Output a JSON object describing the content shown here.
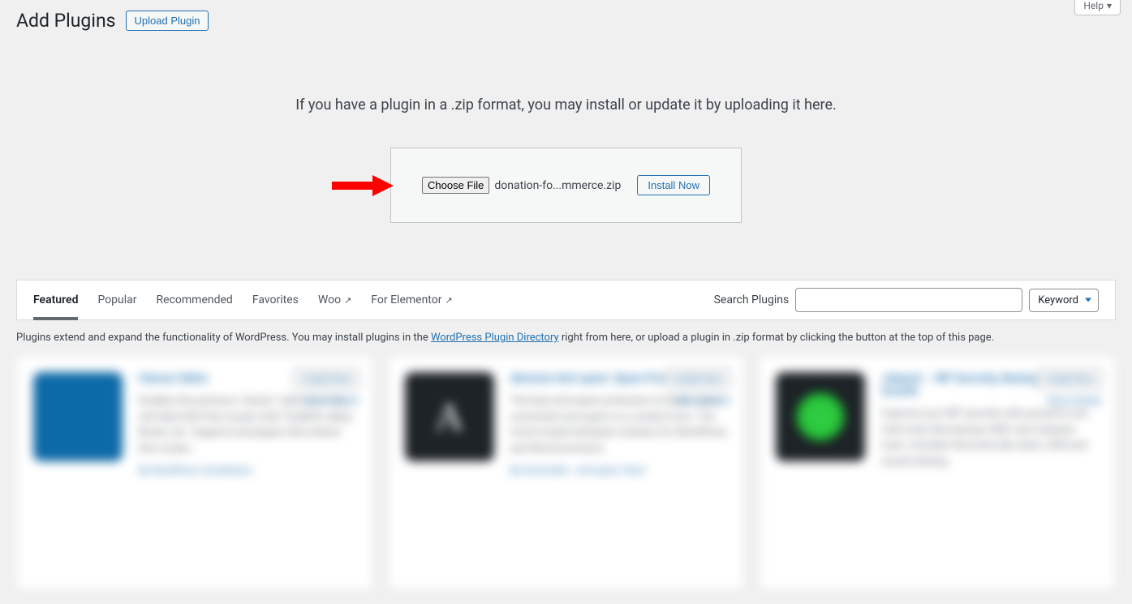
{
  "header": {
    "page_title": "Add Plugins",
    "upload_button": "Upload Plugin",
    "help_button": "Help"
  },
  "upload": {
    "description": "If you have a plugin in a .zip format, you may install or update it by uploading it here.",
    "choose_file_label": "Choose File",
    "selected_file": "donation-fo...mmerce.zip",
    "install_button": "Install Now"
  },
  "tabs": [
    {
      "label": "Featured",
      "active": true,
      "external": false
    },
    {
      "label": "Popular",
      "active": false,
      "external": false
    },
    {
      "label": "Recommended",
      "active": false,
      "external": false
    },
    {
      "label": "Favorites",
      "active": false,
      "external": false
    },
    {
      "label": "Woo",
      "active": false,
      "external": true
    },
    {
      "label": "For Elementor",
      "active": false,
      "external": true
    }
  ],
  "search": {
    "label": "Search Plugins",
    "keyword_label": "Keyword"
  },
  "description": {
    "prefix": "Plugins extend and expand the functionality of WordPress. You may install plugins in the ",
    "link_text": "WordPress Plugin Directory",
    "suffix": " right from here, or upload a plugin in .zip format by clicking the button at the top of this page."
  },
  "plugins": [
    {
      "title": "Classic Editor",
      "description": "Enables the previous \"classic\" editor and the old-style Edit Post screen with TinyMCE, Meta Boxes, etc. Supports all plugins that extend this screen.",
      "author": "By WordPress Contributors",
      "install": "Install Now",
      "details": "More Details",
      "icon_type": "blue"
    },
    {
      "title": "Akismet Anti-spam: Spam Protection",
      "description": "The best anti-spam protection to block spam comments and spam in a contact form. The most trusted antispam solution for WordPress and WooCommerce.",
      "author": "By Automattic - Anti-spam Team",
      "install": "Install Now",
      "details": "More Details",
      "icon_type": "dark",
      "icon_letter": "A"
    },
    {
      "title": "Jetpack – WP Security, Backup, Speed, & Growth",
      "description": "Improve your WP security with powerful one-click tools like backup, WAF, and malware scan. Includes free tools like stats, CDN and social sharing.",
      "author": "",
      "install": "Install Now",
      "details": "More Details",
      "icon_type": "dark2"
    }
  ]
}
